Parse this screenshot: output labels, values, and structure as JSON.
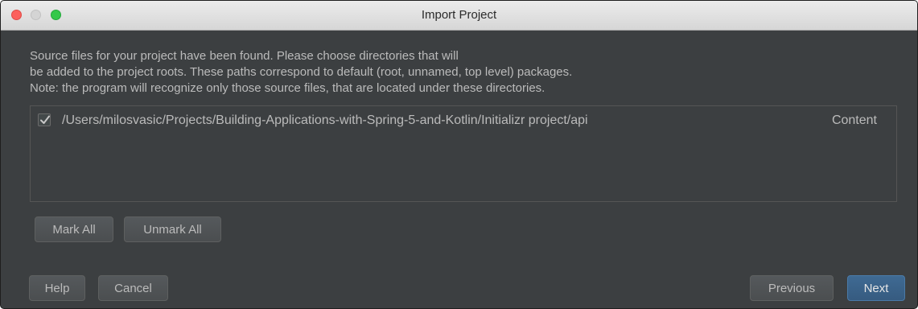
{
  "window": {
    "title": "Import Project"
  },
  "message": {
    "lines": [
      "Source files for your project have been found. Please choose directories that will",
      "be added to the project roots. These paths correspond to default (root, unnamed, top level) packages.",
      "Note: the program will recognize only those source files, that are located under these directories."
    ]
  },
  "directories": [
    {
      "checked": true,
      "path": "/Users/milosvasic/Projects/Building-Applications-with-Spring-5-and-Kotlin/Initializr project/api",
      "type": "Content"
    }
  ],
  "buttons": {
    "mark_all": "Mark All",
    "unmark_all": "Unmark All",
    "help": "Help",
    "cancel": "Cancel",
    "previous": "Previous",
    "next": "Next"
  },
  "colors": {
    "background": "#3c3f41",
    "text": "#bbbbbb",
    "default_button": "#365b80",
    "close_light": "#fc605c",
    "maximize_light": "#34c84a"
  },
  "icons": {
    "checkbox": "checkmark-icon"
  }
}
